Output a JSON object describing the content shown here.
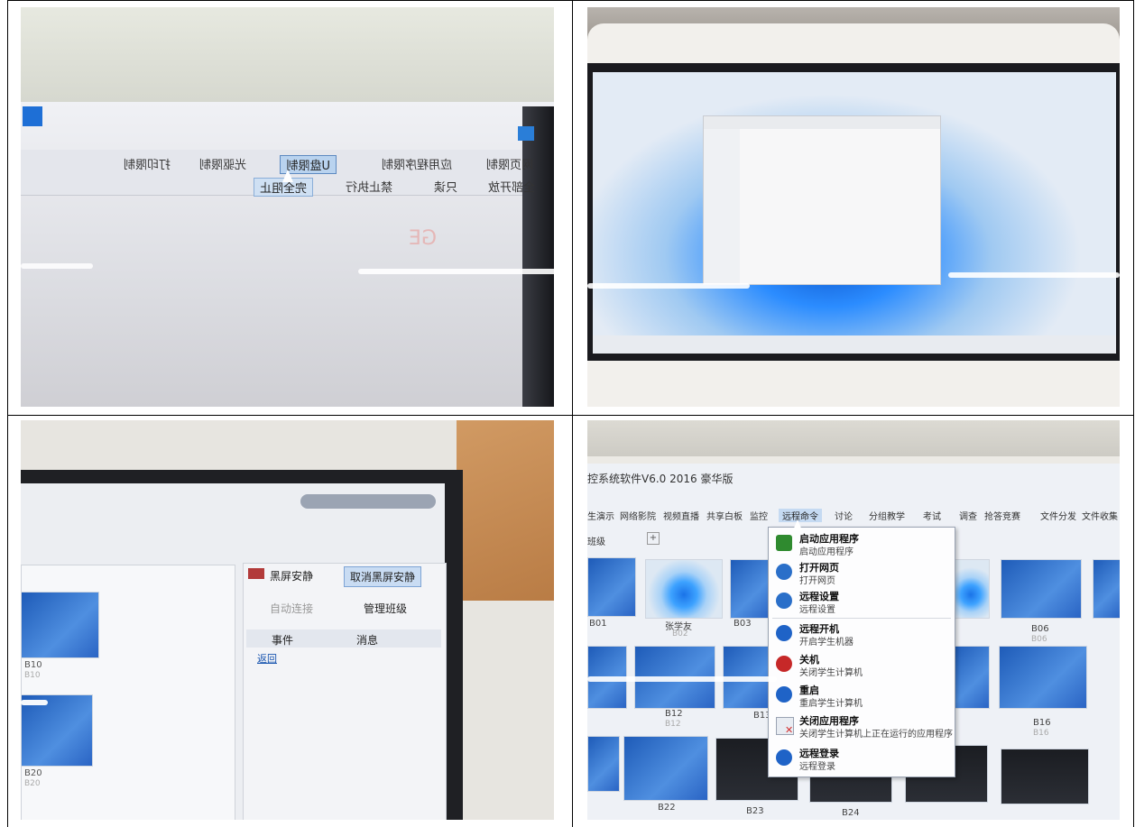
{
  "photo1": {
    "toolbar_row1": [
      "网页限制",
      "应用程序限制",
      "U盘限制",
      "光驱限制",
      "打印限制"
    ],
    "toolbar_row2": [
      "全部开放",
      "只读",
      "禁止执行",
      "完全阻止"
    ],
    "watermark": "GE"
  },
  "photo3": {
    "buttons": [
      "黑屏安静",
      "取消黑屏安静",
      "自动连接",
      "管理班级"
    ],
    "tabs": [
      "事件",
      "消息"
    ],
    "back_link": "返回",
    "thumb_labels": [
      "B10",
      "B10",
      "B20",
      "B20"
    ]
  },
  "photo4": {
    "title": "控系统软件V6.0 2016 豪华版",
    "toolbar": [
      "生演示",
      "网络影院",
      "视频直播",
      "共享白板",
      "监控",
      "远程命令",
      "讨论",
      "分组教学",
      "考试",
      "调查",
      "抢答竞赛",
      "文件分发",
      "文件收集"
    ],
    "tab_label": "班级",
    "menu": [
      {
        "title": "启动应用程序",
        "sub": "启动应用程序",
        "icon": "start-app-icon"
      },
      {
        "title": "打开网页",
        "sub": "打开网页",
        "icon": "web-icon"
      },
      {
        "title": "远程设置",
        "sub": "远程设置",
        "icon": "settings-icon"
      },
      {
        "title": "远程开机",
        "sub": "开启学生机器",
        "icon": "power-on-icon"
      },
      {
        "title": "关机",
        "sub": "关闭学生计算机",
        "icon": "shutdown-icon"
      },
      {
        "title": "重启",
        "sub": "重启学生计算机",
        "icon": "restart-icon"
      },
      {
        "title": "关闭应用程序",
        "sub": "关闭学生计算机上正在运行的应用程序",
        "icon": "close-app-icon"
      },
      {
        "title": "远程登录",
        "sub": "远程登录",
        "icon": "login-icon"
      }
    ],
    "thumb_labels": [
      "B01",
      "张学友",
      "B02",
      "B03",
      "B06",
      "B06",
      "B12",
      "B12",
      "B13",
      "B16",
      "B16",
      "B22",
      "B23",
      "B24"
    ]
  }
}
